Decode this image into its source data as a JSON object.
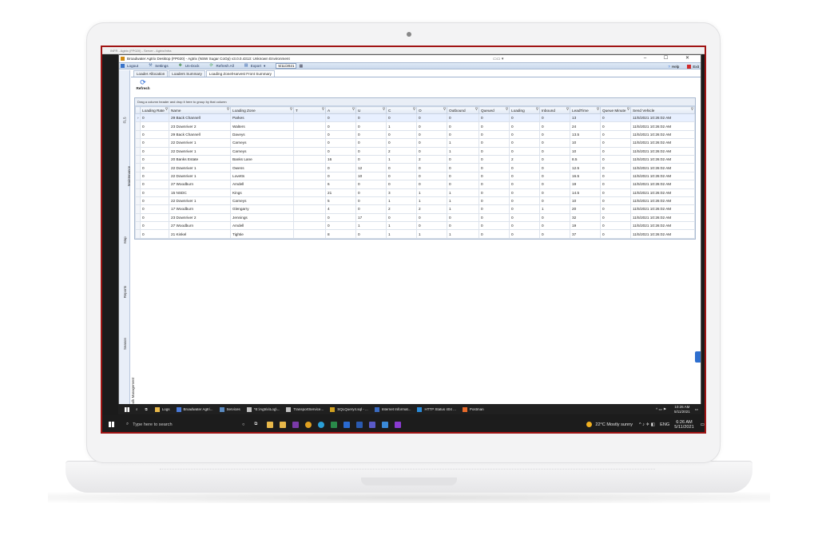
{
  "vm_bar": {
    "title": "INFR - Agtrix (FP020) - Server - Agtrix/Infra"
  },
  "app": {
    "title": "Broadwater Agtrix Desktop (FP020) - Agtrix (NSW Sugar CoOp) v3.0.0.4313: Unknown Environment",
    "window_controls": "–  ☐  ✕"
  },
  "toolbar": {
    "logout": "Logout",
    "settings": "Settings",
    "undock": "Un-Dock",
    "refresh_all": "Refresh All",
    "export": "Export",
    "date": "5/11/2021",
    "help": "Help",
    "exit": "Exit"
  },
  "sidebar": {
    "tabs": [
      "FLS",
      "Maintenance",
      "Map",
      "Reports",
      "Season",
      "Bulk Management"
    ]
  },
  "tabs": [
    "Loader Allocation",
    "Loaders Summary",
    "Loading Zone/Harvest Front Summary"
  ],
  "refresh_label": "Refresh",
  "grid": {
    "group_hint": "Drag a column header and drop it here to group by that column",
    "columns": [
      "Loading Rate",
      "Name",
      "Loading Zone",
      "T",
      "A",
      "U",
      "C",
      "O",
      "Outbound",
      "Queued",
      "Loading",
      "Inbound",
      "LeadTime",
      "Queue Minute",
      "Send Vehicle"
    ],
    "rows": [
      [
        "0",
        "29 Back Channell",
        "Parkes",
        "",
        "0",
        "0",
        "0",
        "0",
        "0",
        "0",
        "0",
        "0",
        "13",
        "0",
        "11/5/2021 10:26:02 AM"
      ],
      [
        "0",
        "23 Downriver 2",
        "Walters",
        "",
        "0",
        "0",
        "1",
        "0",
        "0",
        "0",
        "0",
        "0",
        "24",
        "0",
        "11/5/2021 10:26:02 AM"
      ],
      [
        "0",
        "29 Back Channell",
        "Daveys",
        "",
        "0",
        "0",
        "0",
        "0",
        "0",
        "0",
        "0",
        "0",
        "13.5",
        "0",
        "11/5/2021 10:26:02 AM"
      ],
      [
        "0",
        "22 Downriver 1",
        "Carneys",
        "",
        "0",
        "0",
        "0",
        "0",
        "1",
        "0",
        "0",
        "0",
        "10",
        "0",
        "11/5/2021 10:26:02 AM"
      ],
      [
        "0",
        "22 Downriver 1",
        "Carneys",
        "",
        "0",
        "0",
        "2",
        "0",
        "1",
        "0",
        "0",
        "0",
        "10",
        "0",
        "11/5/2021 10:26:02 AM"
      ],
      [
        "0",
        "20 Banks Estate",
        "Banks Lane",
        "",
        "16",
        "0",
        "1",
        "2",
        "0",
        "0",
        "2",
        "0",
        "8.5",
        "0",
        "11/5/2021 10:26:02 AM"
      ],
      [
        "0",
        "22 Downriver 1",
        "Owens",
        "",
        "0",
        "12",
        "0",
        "0",
        "0",
        "0",
        "0",
        "0",
        "12.5",
        "0",
        "11/5/2021 10:26:02 AM"
      ],
      [
        "0",
        "22 Downriver 1",
        "Lovetts",
        "",
        "0",
        "10",
        "0",
        "0",
        "0",
        "0",
        "0",
        "0",
        "16.5",
        "0",
        "11/5/2021 10:26:02 AM"
      ],
      [
        "0",
        "27 Woodburn",
        "Amdell",
        "",
        "6",
        "0",
        "0",
        "0",
        "0",
        "0",
        "0",
        "0",
        "19",
        "0",
        "11/5/2021 10:26:02 AM"
      ],
      [
        "0",
        "15 NSDC",
        "Kings",
        "",
        "21",
        "0",
        "3",
        "1",
        "1",
        "0",
        "0",
        "0",
        "14.5",
        "0",
        "11/5/2021 10:26:02 AM"
      ],
      [
        "0",
        "22 Downriver 1",
        "Carneys",
        "",
        "5",
        "0",
        "1",
        "1",
        "1",
        "0",
        "0",
        "0",
        "10",
        "0",
        "11/5/2021 10:26:02 AM"
      ],
      [
        "0",
        "17 Woodburn",
        "Glengarry",
        "",
        "4",
        "0",
        "2",
        "2",
        "1",
        "0",
        "0",
        "1",
        "20",
        "0",
        "11/5/2021 10:26:02 AM"
      ],
      [
        "0",
        "23 Downriver 2",
        "Jennings",
        "",
        "0",
        "17",
        "0",
        "0",
        "0",
        "0",
        "0",
        "0",
        "32",
        "0",
        "11/5/2021 10:26:02 AM"
      ],
      [
        "0",
        "27 Woodburn",
        "Amdell",
        "",
        "0",
        "1",
        "1",
        "0",
        "0",
        "0",
        "0",
        "0",
        "19",
        "0",
        "11/5/2021 10:26:02 AM"
      ],
      [
        "0",
        "21 Kinkel",
        "Tightie",
        "",
        "8",
        "0",
        "1",
        "1",
        "1",
        "0",
        "0",
        "0",
        "37",
        "0",
        "11/5/2021 10:26:02 AM"
      ]
    ]
  },
  "inner_taskbar": {
    "items": [
      "Logs",
      "Broadwater Agtri...",
      "Services",
      "*E:\\Agtrix\\Log\\...",
      "TransportService...",
      "SQLQuery4.sql - ...",
      "Internet Informat...",
      "HTTP Status 404 ...",
      "Postman"
    ],
    "time": "10:26 AM",
    "date": "5/11/2021"
  },
  "outer_taskbar": {
    "search_placeholder": "Type here to search",
    "weather": "22°C  Mostly sunny",
    "lang": "ENG",
    "time": "6:26 AM",
    "date": "5/11/2021"
  }
}
